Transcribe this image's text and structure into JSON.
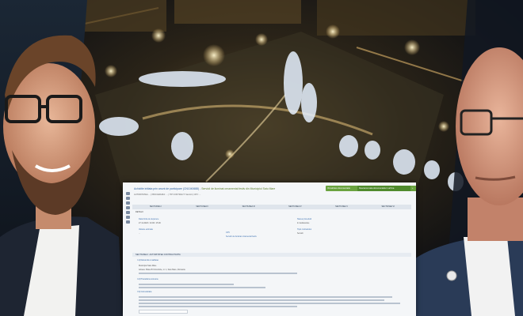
{
  "document": {
    "title": "Achizitie initiata prin anunt de participare (CN1040688) -",
    "title_highlight": "Servicii de iluminat ornamental festiv din Municipiul Satu Mare",
    "meta": "AUTORITATEA ... | PROCEDURA: ... | TIP CONTRACT: Servicii | CPV: ...",
    "buttons": [
      "Vizualizare documentatie",
      "Descarca toata documentatia in arhiva",
      "+"
    ],
    "tabs": [
      "SECTIUNEA I",
      "SECTIUNEA II",
      "SECTIUNEA III",
      "SECTIUNEA IV",
      "SECTIUNEA V",
      "SECTIUNEA VI"
    ],
    "details_label": "DETALII",
    "fields": {
      "deadline_label": "Data limita de depunere",
      "deadline_value": "27.11.2020 / 10.00 / 15.00",
      "state_label": "Starea procedurii",
      "state_value": "In desfasurare",
      "value_label": "Valoare estimata",
      "value_value": "...",
      "contract_label": "Tipul contractului",
      "contract_value": "Servicii",
      "cpv_label": "CPV",
      "cpv_value": "Servicii de iluminat ornamental festiv"
    },
    "section_heading": "SECTIUNEA I: AUTORITATEA CONTRACTANTA",
    "subsections": [
      "I.1) Denumire si adrese",
      "I.2) Procedura comuna",
      "I.3) Comunicare"
    ],
    "authority_name": "Municipiul Satu Mare",
    "authority_address": "Adresa: Piata 25 Octombrie, nr. 1, Satu Mare, Romania"
  }
}
